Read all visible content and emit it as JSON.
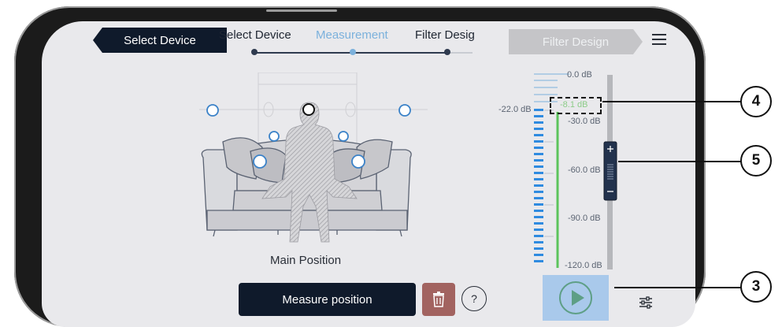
{
  "nav": {
    "back_label": "Select Device",
    "next_label": "Filter Design",
    "steps": [
      "Select Device",
      "Measurement",
      "Filter Desig"
    ]
  },
  "scene": {
    "position_label": "Main Position"
  },
  "actions": {
    "measure_label": "Measure position",
    "help_label": "?"
  },
  "meter": {
    "scale_labels": [
      "0.0 dB",
      "-30.0 dB",
      "-60.0 dB",
      "-90.0 dB",
      "-120.0 dB"
    ],
    "input_level_label": "-22.0 dB",
    "current_level_label": "-8.1 dB",
    "slider_level_db": -60.0
  },
  "callouts": [
    "4",
    "5",
    "3"
  ],
  "colors": {
    "dark_navy": "#0f1a2b",
    "accent_blue": "#7bb1dc",
    "meter_blue": "#2f8be0",
    "level_green": "#5cc45c",
    "trash_red": "#a26360"
  },
  "icons": [
    "menu-icon",
    "trash-icon",
    "help-icon",
    "play-icon",
    "filter-settings-icon"
  ]
}
